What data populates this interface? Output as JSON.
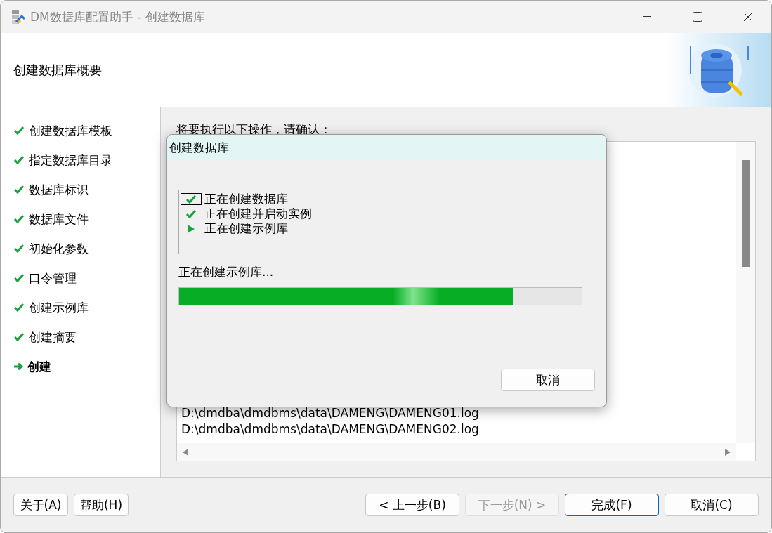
{
  "window": {
    "title": "DM数据库配置助手 - 创建数据库"
  },
  "header": {
    "title": "创建数据库概要"
  },
  "steps": [
    {
      "label": "创建数据库模板",
      "kind": "done",
      "selected": false
    },
    {
      "label": "指定数据库目录",
      "kind": "done",
      "selected": false
    },
    {
      "label": "数据库标识",
      "kind": "done",
      "selected": false
    },
    {
      "label": "数据库文件",
      "kind": "done",
      "selected": false
    },
    {
      "label": "初始化参数",
      "kind": "done",
      "selected": false
    },
    {
      "label": "口令管理",
      "kind": "done",
      "selected": false
    },
    {
      "label": "创建示例库",
      "kind": "done",
      "selected": false
    },
    {
      "label": "创建摘要",
      "kind": "done",
      "selected": false
    },
    {
      "label": "创建",
      "kind": "current",
      "selected": true
    }
  ],
  "summary": {
    "prompt": "将要执行以下操作，请确认：",
    "lines": [
      "D:\\dmdba\\dmdbms\\data\\DAMENG\\DAMENG01.log",
      "D:\\dmdba\\dmdbms\\data\\DAMENG\\DAMENG02.log"
    ]
  },
  "dialog": {
    "title": "创建数据库",
    "tasks": [
      {
        "label": "正在创建数据库",
        "kind": "done",
        "focused": true
      },
      {
        "label": "正在创建并启动实例",
        "kind": "done",
        "focused": false
      },
      {
        "label": "正在创建示例库",
        "kind": "running",
        "focused": false
      }
    ],
    "status": "正在创建示例库...",
    "progress": {
      "level": 0.83
    },
    "cancel_button": "取消"
  },
  "footer": {
    "left_buttons": [
      {
        "label": "关于(A)",
        "disabled": false,
        "default": false
      },
      {
        "label": "帮助(H)",
        "disabled": false,
        "default": false
      }
    ],
    "right_buttons": [
      {
        "label": "< 上一步(B)",
        "disabled": false,
        "default": false
      },
      {
        "label": "下一步(N) >",
        "disabled": true,
        "default": false
      },
      {
        "label": "完成(F)",
        "disabled": false,
        "default": true
      },
      {
        "label": "取消(C)",
        "disabled": false,
        "default": false
      }
    ]
  }
}
